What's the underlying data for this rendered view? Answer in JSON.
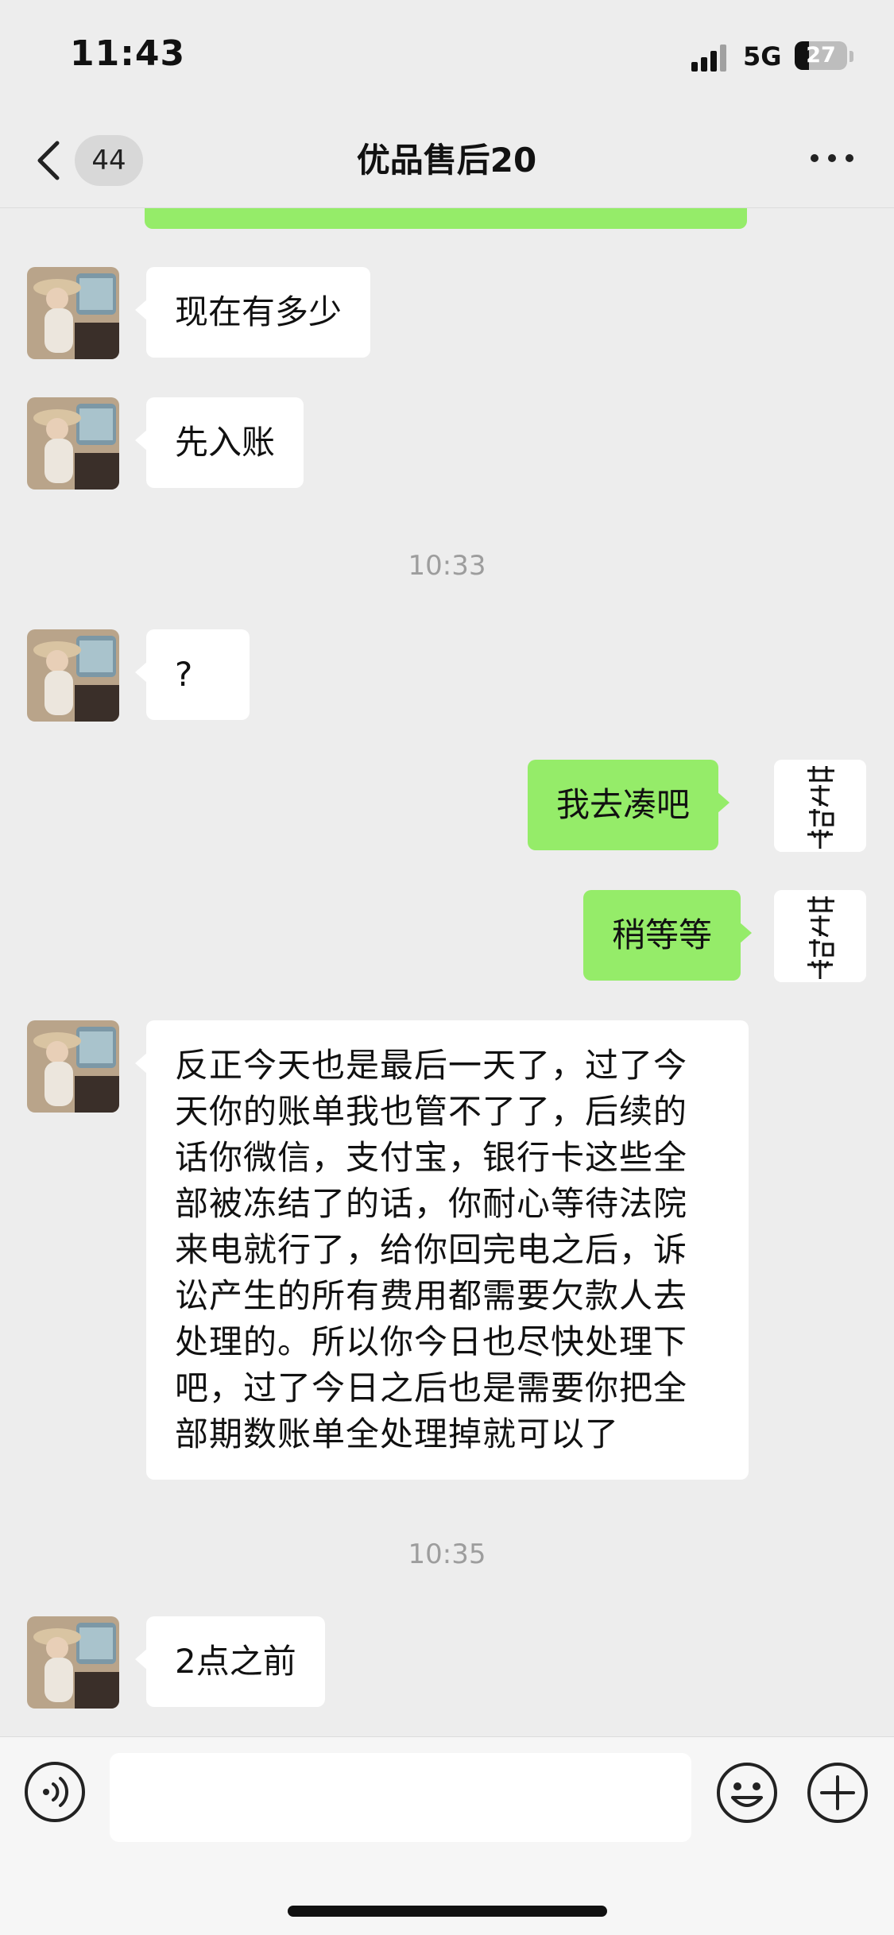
{
  "status_bar": {
    "time": "11:43",
    "network": "5G",
    "battery": "27"
  },
  "nav": {
    "unread_count": "44",
    "title": "优品售后20"
  },
  "messages": [
    {
      "side": "in",
      "type": "text",
      "text": "现在有多少"
    },
    {
      "side": "in",
      "type": "text",
      "text": "先入账"
    },
    {
      "type": "time",
      "text": "10:33"
    },
    {
      "side": "in",
      "type": "text",
      "text": "?"
    },
    {
      "side": "out",
      "type": "text",
      "text": "我去凑吧"
    },
    {
      "side": "out",
      "type": "text",
      "text": "稍等等"
    },
    {
      "side": "in",
      "type": "text",
      "text": "反正今天也是最后一天了，过了今天你的账单我也管不了了，后续的话你微信，支付宝，银行卡这些全部被冻结了的话，你耐心等待法院来电就行了，给你回完电之后，诉讼产生的所有费用都需要欠款人去处理的。所以你今日也尽快处理下吧，过了今日之后也是需要你把全部期数账单全处理掉就可以了"
    },
    {
      "type": "time",
      "text": "10:35"
    },
    {
      "side": "in",
      "type": "text",
      "text": "2点之前"
    }
  ],
  "avatars": {
    "contact": "contact-avatar",
    "self": "self-avatar-calligraphy"
  },
  "colors": {
    "background": "#ededed",
    "bubble_out": "#95ec69",
    "bubble_in": "#ffffff",
    "time_text": "#9d9d9d"
  },
  "input": {
    "placeholder": ""
  }
}
